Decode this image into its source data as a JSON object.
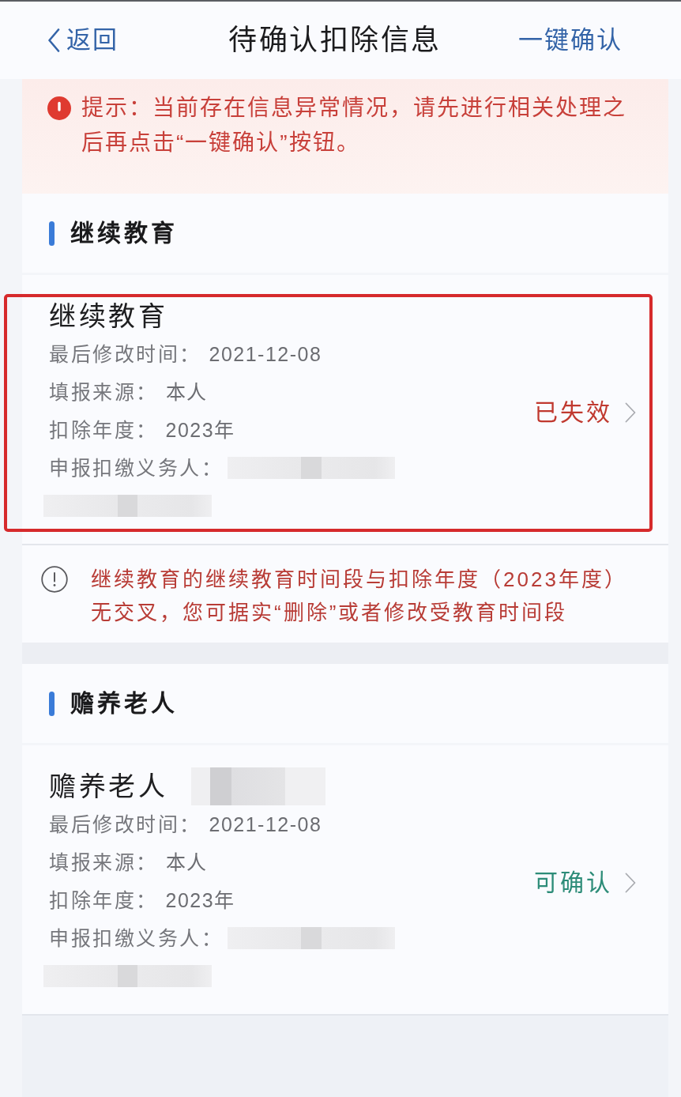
{
  "nav": {
    "back": "返回",
    "title": "待确认扣除信息",
    "action": "一键确认"
  },
  "alert": {
    "text": "提示：当前存在信息异常情况，请先进行相关处理之后再点击“一键确认”按钮。"
  },
  "sections": [
    {
      "title": "继续教育",
      "items": [
        {
          "title": "继续教育",
          "title_redacted": false,
          "highlighted": true,
          "fields": [
            {
              "label": "最后修改时间：",
              "value": "2021-12-08",
              "redacted": false
            },
            {
              "label": "填报来源：",
              "value": "本人",
              "redacted": false
            },
            {
              "label": "扣除年度：",
              "value": "2023年",
              "redacted": false
            },
            {
              "label": "申报扣缴义务人：",
              "redacted": true
            }
          ],
          "status": {
            "text": "已失效",
            "kind": "invalid"
          }
        }
      ],
      "notice": {
        "text": "继续教育的继续教育时间段与扣除年度（2023年度）无交叉，您可据实“删除”或者修改受教育时间段"
      }
    },
    {
      "title": "赡养老人",
      "items": [
        {
          "title": "赡养老人",
          "title_redacted": true,
          "highlighted": false,
          "fields": [
            {
              "label": "最后修改时间：",
              "value": "2021-12-08",
              "redacted": false
            },
            {
              "label": "填报来源：",
              "value": "本人",
              "redacted": false
            },
            {
              "label": "扣除年度：",
              "value": "2023年",
              "redacted": false
            },
            {
              "label": "申报扣缴义务人：",
              "redacted": true
            }
          ],
          "status": {
            "text": "可确认",
            "kind": "confirmable"
          }
        }
      ]
    }
  ]
}
